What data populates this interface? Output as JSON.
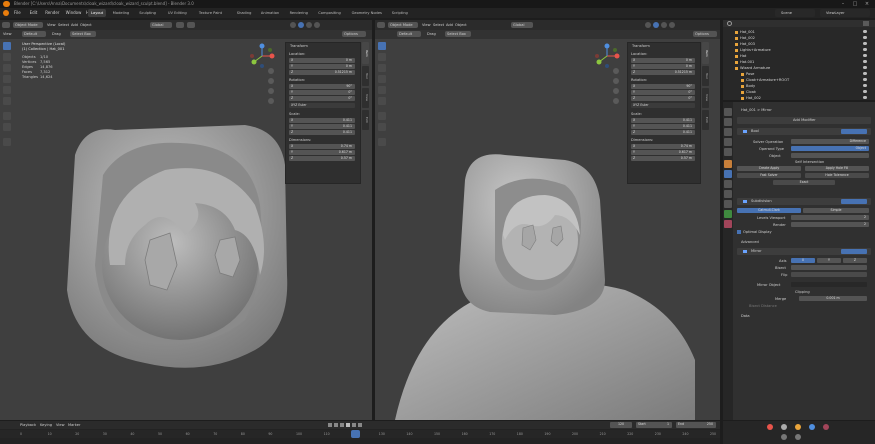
{
  "title": {
    "text": "Blender [C:\\Users\\Anna\\Documents\\cloak_wizard\\cloak_wizard_sculpt.blend] - Blender 3.0"
  },
  "menu": [
    "File",
    "Edit",
    "Render",
    "Window",
    "Help"
  ],
  "workspaces": [
    {
      "label": "Layout",
      "active": true
    },
    {
      "label": "Modeling",
      "active": false
    },
    {
      "label": "Sculpting",
      "active": false
    },
    {
      "label": "UV Editing",
      "active": false
    },
    {
      "label": "Texture Paint",
      "active": false
    },
    {
      "label": "Shading",
      "active": false
    },
    {
      "label": "Animation",
      "active": false
    },
    {
      "label": "Rendering",
      "active": false
    },
    {
      "label": "Compositing",
      "active": false
    },
    {
      "label": "Geometry Nodes",
      "active": false
    },
    {
      "label": "Scripting",
      "active": false
    }
  ],
  "scene": {
    "name": "Scene",
    "view_layer": "ViewLayer"
  },
  "viewport_left": {
    "mode": "Object Mode",
    "menus": [
      "View",
      "Select",
      "Add",
      "Object"
    ],
    "orientation": "Global",
    "transform": "Default",
    "drag": "Drag",
    "select": "Select Box",
    "options": "Options",
    "overlay_title": "User Perspective (Local)",
    "overlay_collection": "(1) Collection | Hat_001",
    "stats": [
      {
        "label": "Objects",
        "value": "1/10"
      },
      {
        "label": "Vertices",
        "value": "7,565"
      },
      {
        "label": "Edges",
        "value": "14,876"
      },
      {
        "label": "Faces",
        "value": "7,312"
      },
      {
        "label": "Triangles",
        "value": "14,624"
      }
    ]
  },
  "viewport_right": {
    "mode": "Object Mode",
    "menus": [
      "View",
      "Select",
      "Add",
      "Object"
    ],
    "orientation": "Global",
    "transform": "Default",
    "drag": "Drag",
    "select": "Select Box",
    "options": "Options"
  },
  "npanel": {
    "header": "Transform",
    "location_label": "Location:",
    "location": [
      {
        "axis": "X",
        "value": "0 m"
      },
      {
        "axis": "Y",
        "value": "0 m"
      },
      {
        "axis": "Z",
        "value": "0.51215 m"
      }
    ],
    "rotation_label": "Rotation:",
    "rotation": [
      {
        "axis": "X",
        "value": "90°"
      },
      {
        "axis": "Y",
        "value": "0°"
      },
      {
        "axis": "Z",
        "value": "0°"
      }
    ],
    "rotation_mode": "XYZ Euler",
    "scale_label": "Scale:",
    "scale": [
      {
        "axis": "X",
        "value": "0.411"
      },
      {
        "axis": "Y",
        "value": "0.411"
      },
      {
        "axis": "Z",
        "value": "0.411"
      }
    ],
    "dimensions_label": "Dimensions:",
    "dimensions": [
      {
        "axis": "X",
        "value": "0.74 m"
      },
      {
        "axis": "Y",
        "value": "0.617 m"
      },
      {
        "axis": "Z",
        "value": "0.57 m"
      }
    ],
    "tabs": [
      "Item",
      "Tool",
      "View",
      "Edit"
    ]
  },
  "npanel_right": {
    "location": [
      {
        "axis": "X",
        "value": "0 m"
      },
      {
        "axis": "Y",
        "value": "0 m"
      },
      {
        "axis": "Z",
        "value": "0.51215 m"
      }
    ],
    "rotation": [
      {
        "axis": "X",
        "value": "90°"
      },
      {
        "axis": "Y",
        "value": "0°"
      },
      {
        "axis": "Z",
        "value": "0°"
      }
    ],
    "rotation_mode": "XYZ Euler",
    "scale": [
      {
        "axis": "X",
        "value": "0.411"
      },
      {
        "axis": "Y",
        "value": "0.411"
      },
      {
        "axis": "Z",
        "value": "0.411"
      }
    ],
    "dimensions": [
      {
        "axis": "X",
        "value": "0.74 m"
      },
      {
        "axis": "Y",
        "value": "0.617 m"
      },
      {
        "axis": "Z",
        "value": "0.57 m"
      }
    ]
  },
  "outliner": {
    "items": [
      {
        "label": "Hat_001",
        "indent": 1
      },
      {
        "label": "Hat_002",
        "indent": 1
      },
      {
        "label": "Hat_003",
        "indent": 1
      },
      {
        "label": "Lights+Armature",
        "indent": 1
      },
      {
        "label": "Hat",
        "indent": 1
      },
      {
        "label": "Hat.001",
        "indent": 1
      },
      {
        "label": "Wizard Armature",
        "indent": 1
      },
      {
        "label": "Pose",
        "indent": 2
      },
      {
        "label": "Cloak+Armature+ROOT",
        "indent": 2
      },
      {
        "label": "Body",
        "indent": 2
      },
      {
        "label": "Cloak",
        "indent": 2
      },
      {
        "label": "Hat_002",
        "indent": 2
      }
    ]
  },
  "properties": {
    "breadcrumb": "Hat_001 > Mirror",
    "add_modifier": "Add Modifier",
    "boolean": {
      "name": "Bool",
      "solver_label": "Solver Operation",
      "solver_value": "Difference",
      "operand_label": "Operand Type",
      "operand_value": "Object",
      "row_object": "Object",
      "self_intersection": "Self Intersection"
    },
    "buttons": [
      "Create Apply",
      "Apply Hole Fill",
      "Fast Solver",
      "Hole Tolerance",
      "Exact"
    ],
    "subdivision": {
      "name": "Subdivision",
      "tabs": [
        "Catmull-Clark",
        "Simple"
      ],
      "levels_viewport_label": "Levels Viewport",
      "levels_viewport_value": "2",
      "render_label": "Render",
      "render_value": "2",
      "optimal_display": "Optimal Display",
      "advanced": "Advanced"
    },
    "mirror": {
      "name": "Mirror",
      "axis_label": "Axis",
      "axis": [
        "X",
        "Y",
        "Z"
      ],
      "bisect_label": "Bisect",
      "flip_label": "Flip",
      "mirror_object_label": "Mirror Object",
      "clipping": "Clipping",
      "merge_label": "Merge",
      "merge_value": "0.001 m",
      "bisect_distance": "Bisect Distance",
      "data": "Data"
    }
  },
  "timeline": {
    "menus": [
      "Playback",
      "Keying",
      "View",
      "Marker"
    ],
    "frames": [
      "0",
      "10",
      "20",
      "30",
      "40",
      "50",
      "60",
      "70",
      "80",
      "90",
      "100",
      "110",
      "120",
      "130",
      "140",
      "150",
      "160",
      "170",
      "180",
      "190",
      "200",
      "210",
      "220",
      "230",
      "240",
      "250"
    ],
    "current_frame": "120",
    "start_label": "Start",
    "start": "1",
    "end_label": "End",
    "end": "250"
  },
  "colors": {
    "accent": "#4772b3",
    "x_axis": "#e8544b",
    "y_axis": "#8cc63f",
    "z_axis": "#4f8fe0",
    "mesh": "#9b9b9b",
    "viewport_bg": "#3f3f3f"
  }
}
